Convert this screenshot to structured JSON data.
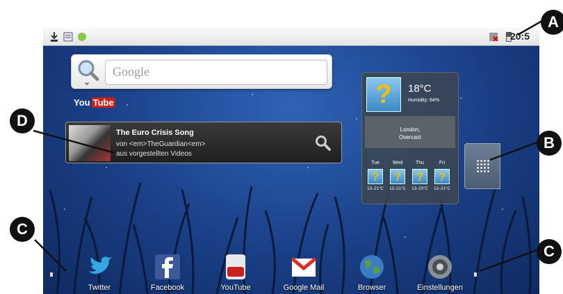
{
  "status_bar": {
    "clock": "20:5",
    "left_icons": [
      "download-icon",
      "notes-icon",
      "android-icon"
    ],
    "right_icons": [
      "sim-error-icon",
      "battery-icon"
    ]
  },
  "search_widget": {
    "placeholder": "Google"
  },
  "youtube_widget": {
    "logo_you": "You",
    "logo_tube": "Tube",
    "title": "The Euro Crisis Song",
    "line1": "von <em>TheGuardian<em>",
    "line2": "aus vorgestellten Videos"
  },
  "weather_widget": {
    "temperature": "18°C",
    "humidity": "Humidity: 64%",
    "location": "London,",
    "condition": "Overcast",
    "forecast": [
      {
        "day": "Tue",
        "range": "13–21°C"
      },
      {
        "day": "Wed",
        "range": "12–21°C"
      },
      {
        "day": "Thu",
        "range": "13–23°C"
      },
      {
        "day": "Fri",
        "range": "12–21°C"
      }
    ]
  },
  "dock": [
    {
      "label": "Twitter",
      "icon": "twitter-icon"
    },
    {
      "label": "Facebook",
      "icon": "facebook-icon"
    },
    {
      "label": "YouTube",
      "icon": "youtube-icon"
    },
    {
      "label": "Google Mail",
      "icon": "gmail-icon"
    },
    {
      "label": "Browser",
      "icon": "globe-icon"
    },
    {
      "label": "Einstellungen",
      "icon": "settings-icon"
    }
  ],
  "callouts": {
    "a": "A",
    "b": "B",
    "c": "C",
    "d": "D"
  }
}
